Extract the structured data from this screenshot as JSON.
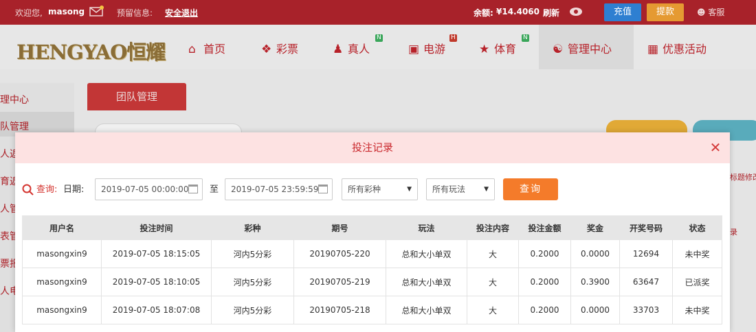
{
  "topbar": {
    "welcome": "欢迎您,",
    "username": "masong",
    "warning": "预留信息:",
    "logout": "安全退出",
    "balance_label": "余额:",
    "balance_value": "¥14.4060",
    "refresh": "刷新",
    "deposit": "充值",
    "withdraw": "提款",
    "service": "客服"
  },
  "nav": {
    "logo_text": "HENGYAO恒耀",
    "items": [
      {
        "label": "首页",
        "icon": "home-icon"
      },
      {
        "label": "彩票",
        "icon": "lottery-icon"
      },
      {
        "label": "真人",
        "icon": "live-icon",
        "badge": "N"
      },
      {
        "label": "电游",
        "icon": "game-icon",
        "badge": "H"
      },
      {
        "label": "体育",
        "icon": "trophy-icon",
        "badge": "N"
      },
      {
        "label": "管理中心",
        "icon": "users-icon"
      },
      {
        "label": "优惠活动",
        "icon": "gift-icon"
      }
    ]
  },
  "sidebar": {
    "items": [
      "理中心",
      "队管理",
      "人返",
      "育返",
      "人管",
      "表管",
      "票报",
      "人电"
    ]
  },
  "main": {
    "tab": "团队管理",
    "bg_right_text": "标题修改",
    "bg_right_text2": "录"
  },
  "modal": {
    "title": "投注记录",
    "query_label": "查询:",
    "date_label": "日期:",
    "date_from": "2019-07-05 00:00:00",
    "to_label": "至",
    "date_to": "2019-07-05 23:59:59",
    "lottery_select": "所有彩种",
    "play_select": "所有玩法",
    "query_button": "查询",
    "columns": [
      "用户名",
      "投注时间",
      "彩种",
      "期号",
      "玩法",
      "投注内容",
      "投注金额",
      "奖金",
      "开奖号码",
      "状态"
    ],
    "rows": [
      [
        "masongxin9",
        "2019-07-05 18:15:05",
        "河内5分彩",
        "20190705-220",
        "总和大小单双",
        "大",
        "0.2000",
        "0.0000",
        "12694",
        "未中奖"
      ],
      [
        "masongxin9",
        "2019-07-05 18:10:05",
        "河内5分彩",
        "20190705-219",
        "总和大小单双",
        "大",
        "0.2000",
        "0.3900",
        "63647",
        "已派奖"
      ],
      [
        "masongxin9",
        "2019-07-05 18:07:08",
        "河内5分彩",
        "20190705-218",
        "总和大小单双",
        "大",
        "0.2000",
        "0.0000",
        "33703",
        "未中奖"
      ]
    ]
  },
  "colors": {
    "brand_red": "#a8222a",
    "accent_orange": "#f47b2a",
    "deposit_blue": "#2e7fd1",
    "withdraw_orange": "#e59a32"
  }
}
